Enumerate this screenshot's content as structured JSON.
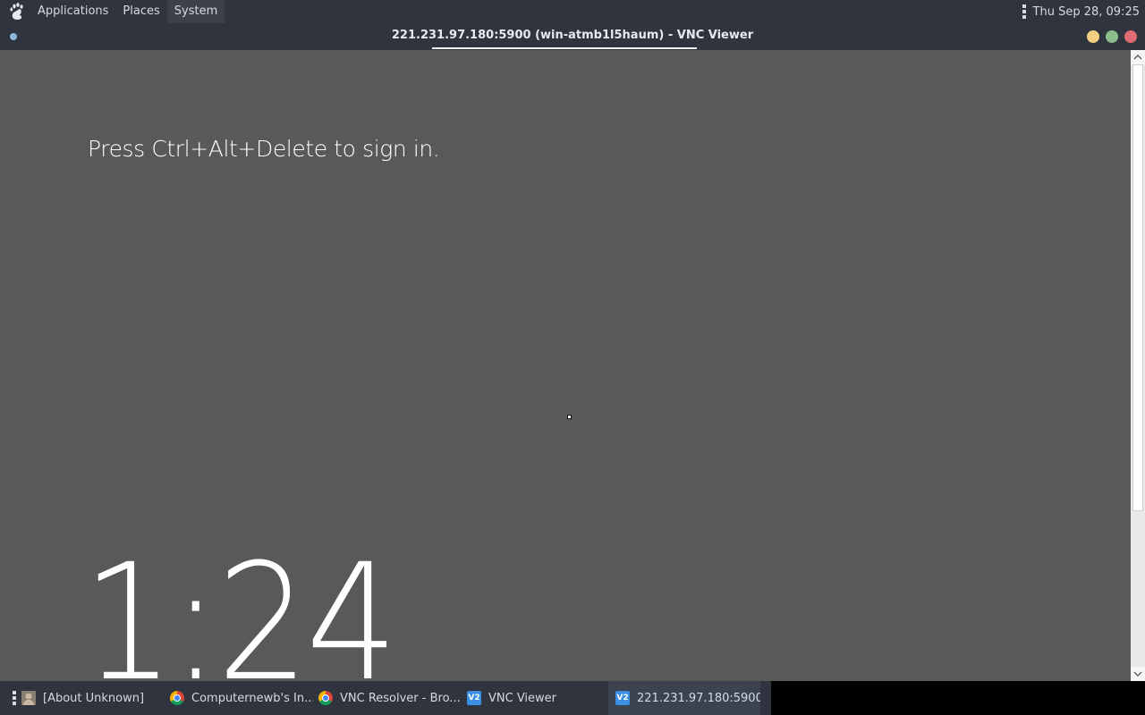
{
  "top_panel": {
    "menus": [
      "Applications",
      "Places",
      "System"
    ],
    "clock": "Thu Sep 28, 09:25",
    "logo_icon": "gnome-foot-icon"
  },
  "window": {
    "title": "221.231.97.180:5900 (win-atmb1l5haum) - VNC Viewer",
    "buttons": [
      "minimize",
      "maximize",
      "close"
    ],
    "button_colors": {
      "minimize": "#f2d07f",
      "maximize": "#8ebd8d",
      "close": "#e06c75"
    }
  },
  "remote_screen": {
    "message": "Press Ctrl+Alt+Delete to sign in.",
    "time": "1:24",
    "background": "#595959"
  },
  "taskbar": {
    "tasks": [
      {
        "label": "[About Unknown]",
        "icon": "user-icon",
        "active": false
      },
      {
        "label": "Computernewb's In...",
        "icon": "chrome-icon",
        "active": false
      },
      {
        "label": "VNC Resolver - Bro...",
        "icon": "chrome-icon",
        "active": false
      },
      {
        "label": "VNC Viewer",
        "icon": "vnc-viewer-icon",
        "active": false
      },
      {
        "label": "221.231.97.180:5900...",
        "icon": "vnc-viewer-icon",
        "active": true
      }
    ],
    "vnc_icon_text": "V2"
  }
}
